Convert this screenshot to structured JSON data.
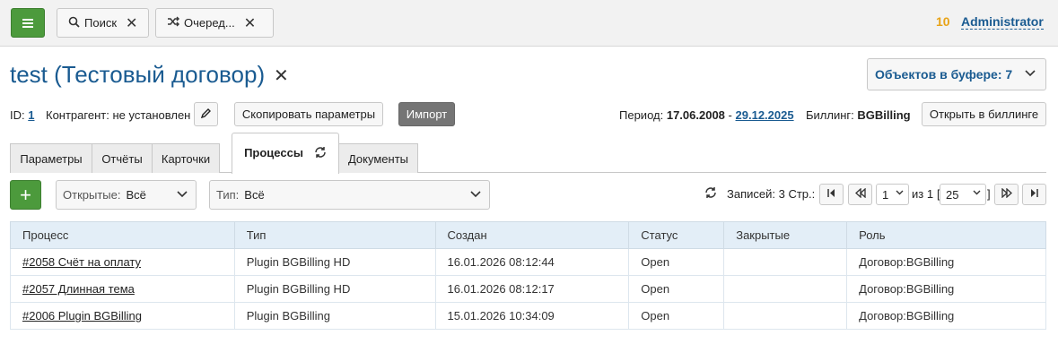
{
  "topbar": {
    "menu_icon": "hamburger-icon",
    "tabs": [
      {
        "icon": "search-icon",
        "label": "Поиск"
      },
      {
        "icon": "shuffle-icon",
        "label": "Очеред..."
      }
    ],
    "close_glyph": "✕",
    "user": {
      "count": "10",
      "name": "Administrator"
    }
  },
  "header": {
    "title": "test (Тестовый договор)",
    "close_glyph": "✕",
    "buffer_label": "Объектов в буфере: 7"
  },
  "info": {
    "id_label": "ID:",
    "id_value": "1",
    "contractor": "Контрагент: не установлен",
    "copy_button": "Скопировать параметры",
    "import_button": "Импорт",
    "period_label": "Период:",
    "period_from": "17.06.2008",
    "period_sep": "-",
    "period_to": "29.12.2025",
    "billing_label": "Биллинг:",
    "billing_value": "BGBilling",
    "open_billing_button": "Открыть в биллинге"
  },
  "tabs": [
    {
      "label": "Параметры"
    },
    {
      "label": "Отчёты"
    },
    {
      "label": "Карточки"
    },
    {
      "label": "Процессы",
      "active": true
    },
    {
      "label": "Документы"
    }
  ],
  "filters": {
    "add_glyph": "+",
    "open": {
      "label": "Открытые:",
      "value": "Всё"
    },
    "type": {
      "label": "Тип:",
      "value": "Всё"
    }
  },
  "pager": {
    "summary": "Записей: 3 Стр.:",
    "page": "1",
    "of": "из 1",
    "size": "25",
    "bracket_open": "[",
    "bracket_close": "]"
  },
  "table": {
    "columns": [
      "Процесс",
      "Тип",
      "Создан",
      "Статус",
      "Закрытые",
      "Роль"
    ],
    "rows": [
      [
        "#2058 Счёт на оплату",
        "Plugin BGBilling HD",
        "16.01.2026 08:12:44",
        "Open",
        "",
        "Договор:BGBilling"
      ],
      [
        "#2057 Длинная тема",
        "Plugin BGBilling HD",
        "16.01.2026 08:12:17",
        "Open",
        "",
        "Договор:BGBilling"
      ],
      [
        "#2006 Plugin BGBilling",
        "Plugin BGBilling",
        "15.01.2026 10:34:09",
        "Open",
        "",
        "Договор:BGBilling"
      ]
    ]
  },
  "colors": {
    "accent": "#4c9a3c",
    "link": "#1a5b91",
    "counter": "#e8a317",
    "header_bg": "#e3eef7"
  }
}
